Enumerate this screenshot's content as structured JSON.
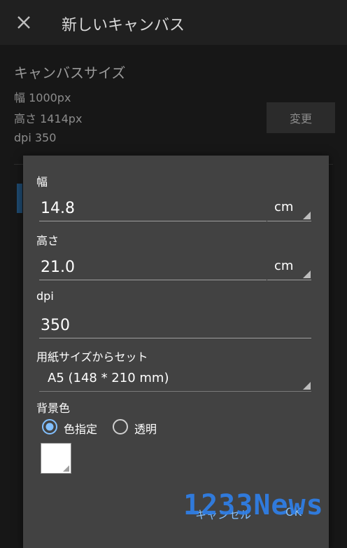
{
  "appbar": {
    "title": "新しいキャンバス",
    "close_icon": "close-icon"
  },
  "canvas_size": {
    "title": "キャンバスサイズ",
    "width": "幅 1000px",
    "height": "高さ 1414px",
    "dpi": "dpi 350",
    "change_label": "変更"
  },
  "dialog": {
    "width": {
      "label": "幅",
      "value": "14.8",
      "unit": "cm"
    },
    "height": {
      "label": "高さ",
      "value": "21.0",
      "unit": "cm"
    },
    "dpi": {
      "label": "dpi",
      "value": "350"
    },
    "paper": {
      "label": "用紙サイズからセット",
      "value": "A5 (148 * 210 mm)"
    },
    "background": {
      "label": "背景色",
      "options": [
        {
          "label": "色指定",
          "selected": true
        },
        {
          "label": "透明",
          "selected": false
        }
      ],
      "swatch_color": "#ffffff"
    },
    "cancel_label": "キャンセル",
    "ok_label": "OK"
  },
  "watermark": "1233News",
  "colors": {
    "accent": "#82c0ff",
    "dialog_bg": "#424242",
    "page_bg": "#171717"
  }
}
